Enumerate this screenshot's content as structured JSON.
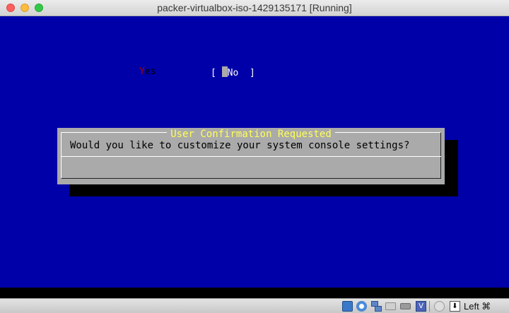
{
  "window": {
    "title": "packer-virtualbox-iso-1429135171 [Running]",
    "colors": {
      "screen_bg": "#0000a8",
      "dialog_bg": "#aaaaaa",
      "title_text": "#ffff55",
      "hotkey": "#a80000"
    }
  },
  "dialog": {
    "title": "User Confirmation Requested",
    "question": "Would you like to customize your system console settings?",
    "yes_label": {
      "hotkey": "Y",
      "rest": "es"
    },
    "no_label": {
      "open": "[ ",
      "hotkey": "N",
      "rest": "o  ]"
    },
    "selected": "No"
  },
  "statusbar": {
    "icons": [
      "hard-disk-icon",
      "optical-disk-icon",
      "network-icon",
      "shared-folder-icon",
      "usb-icon",
      "video-capture-icon",
      "mouse-integration-icon",
      "keyboard-capture-icon"
    ],
    "video_icon_glyph": "V",
    "arrow_icon_glyph": "⬇",
    "host_key": "Left ⌘"
  }
}
